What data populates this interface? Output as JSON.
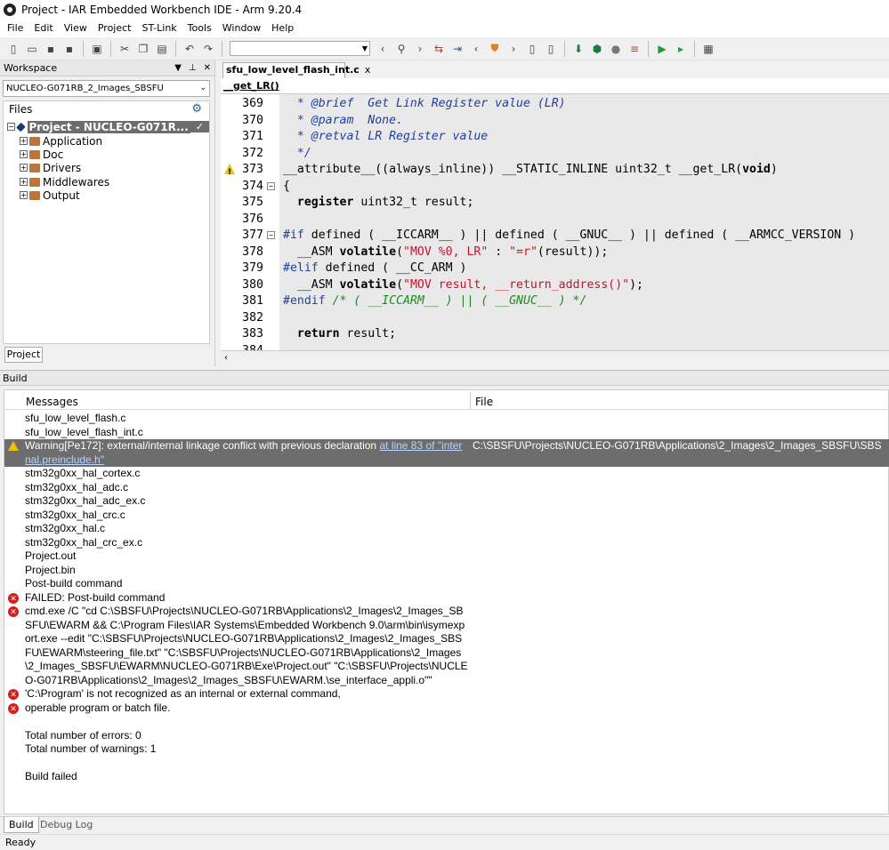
{
  "window": {
    "title": "Project - IAR Embedded Workbench IDE - Arm 9.20.4"
  },
  "menu": [
    "File",
    "Edit",
    "View",
    "Project",
    "ST-Link",
    "Tools",
    "Window",
    "Help"
  ],
  "toolbar": {
    "icons": [
      "new-file-icon",
      "open-icon",
      "save-icon",
      "save-all-icon",
      "print-icon",
      "cut-icon",
      "copy-icon",
      "paste-icon",
      "undo-icon",
      "redo-icon",
      "find-combo",
      "back-icon",
      "search-icon",
      "forward-icon",
      "toggle-bookmark-icon",
      "next-bookmark-icon",
      "prev-icon",
      "shield-icon",
      "next-icon",
      "file-prev-icon",
      "file-next-icon",
      "download-icon",
      "debug-icon",
      "breakpoint-icon",
      "make-icon",
      "run-icon",
      "run-dropdown-icon",
      "stack-icon"
    ]
  },
  "workspace": {
    "title": "Workspace",
    "config": "NUCLEO-G071RB_2_Images_SBSFU",
    "files_label": "Files",
    "project": "Project - NUCLEO-G071R...",
    "folders": [
      "Application",
      "Doc",
      "Drivers",
      "Middlewares",
      "Output"
    ],
    "tab": "Project"
  },
  "editor": {
    "tab": "sfu_low_level_flash_int.c",
    "tab_close": "x",
    "function": "__get_LR()",
    "lines": [
      {
        "n": "369",
        "text": "  * @brief  Get Link Register value (LR)"
      },
      {
        "n": "370",
        "text": "  * @param  None."
      },
      {
        "n": "371",
        "text": "  * @retval LR Register value"
      },
      {
        "n": "372",
        "text": "  */"
      },
      {
        "n": "373",
        "text": "__attribute__((always_inline)) __STATIC_INLINE uint32_t __get_LR(void)"
      },
      {
        "n": "374",
        "text": "{"
      },
      {
        "n": "375",
        "text": "  register uint32_t result;"
      },
      {
        "n": "376",
        "text": ""
      },
      {
        "n": "377",
        "text": "#if defined ( __ICCARM__ ) || defined ( __GNUC__ ) || defined ( __ARMCC_VERSION )"
      },
      {
        "n": "378",
        "text": "  __ASM volatile(\"MOV %0, LR\" : \"=r\"(result));"
      },
      {
        "n": "379",
        "text": "#elif defined ( __CC_ARM )"
      },
      {
        "n": "380",
        "text": "  __ASM volatile(\"MOV result, __return_address()\");"
      },
      {
        "n": "381",
        "text": "#endif /* ( __ICCARM__ ) || ( __GNUC__ ) */"
      },
      {
        "n": "382",
        "text": ""
      },
      {
        "n": "383",
        "text": "  return result;"
      },
      {
        "n": "384",
        "text": ""
      }
    ]
  },
  "build": {
    "title": "Build",
    "col_messages": "Messages",
    "col_file": "File",
    "rows": [
      {
        "type": "",
        "msg": "sfu_low_level_flash.c",
        "file": ""
      },
      {
        "type": "",
        "msg": "sfu_low_level_flash_int.c",
        "file": ""
      },
      {
        "type": "warning",
        "msg": "Warning[Pe172]: external/internal linkage conflict with previous declaration ",
        "link": "at line 83 of \"internal.preinclude.h\"",
        "file": "C:\\SBSFU\\Projects\\NUCLEO-G071RB\\Applications\\2_Images\\2_Images_SBSFU\\SBS"
      },
      {
        "type": "",
        "msg": "stm32g0xx_hal_cortex.c",
        "file": ""
      },
      {
        "type": "",
        "msg": "stm32g0xx_hal_adc.c",
        "file": ""
      },
      {
        "type": "",
        "msg": "stm32g0xx_hal_adc_ex.c",
        "file": ""
      },
      {
        "type": "",
        "msg": "stm32g0xx_hal_crc.c",
        "file": ""
      },
      {
        "type": "",
        "msg": "stm32g0xx_hal.c",
        "file": ""
      },
      {
        "type": "",
        "msg": "stm32g0xx_hal_crc_ex.c",
        "file": ""
      },
      {
        "type": "",
        "msg": "Project.out",
        "file": ""
      },
      {
        "type": "",
        "msg": "Project.bin",
        "file": ""
      },
      {
        "type": "",
        "msg": "Post-build command",
        "file": ""
      },
      {
        "type": "error",
        "msg": "FAILED: Post-build command",
        "file": ""
      },
      {
        "type": "error",
        "msg": "cmd.exe /C \"cd C:\\SBSFU\\Projects\\NUCLEO-G071RB\\Applications\\2_Images\\2_Images_SBSFU\\EWARM && C:\\Program Files\\IAR Systems\\Embedded Workbench 9.0\\arm\\bin\\isymexport.exe --edit \"C:\\SBSFU\\Projects\\NUCLEO-G071RB\\Applications\\2_Images\\2_Images_SBSFU\\EWARM\\steering_file.txt\" \"C:\\SBSFU\\Projects\\NUCLEO-G071RB\\Applications\\2_Images\\2_Images_SBSFU\\EWARM\\NUCLEO-G071RB\\Exe\\Project.out\" \"C:\\SBSFU\\Projects\\NUCLEO-G071RB\\Applications\\2_Images\\2_Images_SBSFU\\EWARM.\\se_interface_appli.o\"\"",
        "file": ""
      },
      {
        "type": "error",
        "msg": "'C:\\Program' is not recognized as an internal or external command,",
        "file": ""
      },
      {
        "type": "error",
        "msg": "operable program or batch file.",
        "file": ""
      },
      {
        "type": "",
        "msg": "",
        "file": ""
      },
      {
        "type": "",
        "msg": "Total number of errors: 0",
        "file": ""
      },
      {
        "type": "",
        "msg": "Total number of warnings: 1",
        "file": ""
      },
      {
        "type": "",
        "msg": "",
        "file": ""
      },
      {
        "type": "",
        "msg": "Build failed",
        "file": ""
      }
    ],
    "tabs": [
      "Build",
      "Debug Log"
    ]
  },
  "status": "Ready",
  "colors": {
    "selection": "#6d6d6d",
    "comment": "#1e3fa0",
    "string": "#c8102e",
    "green_comment": "#1d8a1d",
    "error": "#d81b1b",
    "warning": "#e8c400"
  }
}
